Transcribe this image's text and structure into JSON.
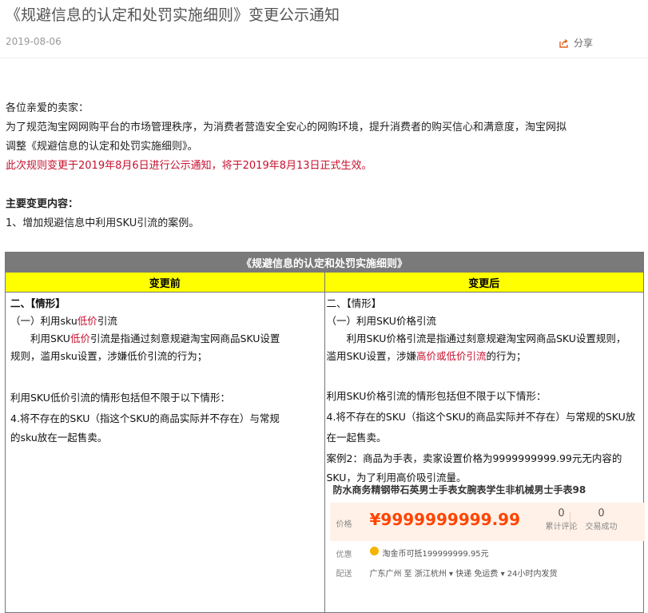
{
  "header": {
    "title": "《规避信息的认定和处罚实施细则》变更公示通知",
    "date": "2019-08-06",
    "share_label": "分享"
  },
  "intro": {
    "greeting": "各位亲爱的卖家：",
    "para_line1": "为了规范淘宝网网购平台的市场管理秩序，为消费者营造安全安心的网购环境，提升消费者的购买信心和满意度，淘宝网拟",
    "para_line2": "调整《规避信息的认定和处罚实施细则》。",
    "notice": "此次规则变更于2019年8月6日进行公示通知，将于2019年8月13日正式生效。",
    "changes_heading": "主要变更内容：",
    "change_item": "1、增加规避信息中利用SKU引流的案例。"
  },
  "table": {
    "title": "《规避信息的认定和处罚实施细则》",
    "col_before": "变更前",
    "col_after": "变更后",
    "before": {
      "l1": "二、【情形】",
      "l2a": "（一）利用sku",
      "l2b": "低价",
      "l2c": "引流",
      "l3a": "　　利用SKU",
      "l3b": "低价",
      "l3c": "引流是指通过刻意规避淘宝网商品SKU设置",
      "l4": "规则，滥用sku设置，涉嫌低价引流的行为；",
      "l5": "利用SKU低价引流的情形包括但不限于以下情形：",
      "l6": "4.将不存在的SKU（指这个SKU的商品实际并不存在）与常规",
      "l7": "的sku放在一起售卖。"
    },
    "after": {
      "l1": "二、【情形】",
      "l2": "（一）利用SKU价格引流",
      "l3": "　　利用SKU价格引流是指通过刻意规避淘宝网商品SKU设置规则，",
      "l4a": "滥用SKU设置，涉嫌",
      "l4b": "高价或低价引流",
      "l4c": "的行为；",
      "l5": "利用SKU价格引流的情形包括但不限于以下情形：",
      "l6": "4.将不存在的SKU（指这个SKU的商品实际并不存在）与常规的SKU放",
      "l7": "在一起售卖。",
      "l8": "案例2：商品为手表，卖家设置价格为9999999999.99元无内容的",
      "l9": "SKU，为了利用高价吸引流量。"
    },
    "product": {
      "title": "防水商务精钢带石英男士手表女腕表学生非机械男士手表98",
      "price_label": "价格",
      "price": "¥9999999999.99",
      "reviews_count": "0",
      "reviews_label": "累计评论",
      "sales_count": "0",
      "sales_label": "交易成功",
      "promo_label": "优惠",
      "promo_text": "淘金币可抵199999999.95元",
      "ship_label": "配送",
      "ship_text": "广东广州 至  浙江杭州 ▾   快递 免运费 ▾   24小时内发货"
    }
  },
  "colors": {
    "red": "#c8102e",
    "header_yellow": "#ffff00",
    "table_title_bg": "#7a7a7a",
    "price_orange": "#ff4400",
    "share_orange": "#e8601c"
  }
}
